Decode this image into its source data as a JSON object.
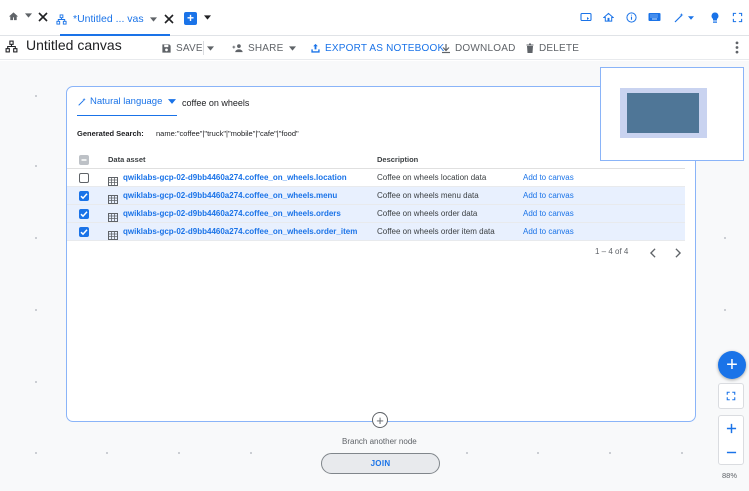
{
  "tabs": {
    "active_title": "*Untitled ... vas"
  },
  "toolbar": {
    "title": "Untitled canvas",
    "save": "SAVE",
    "share": "SHARE",
    "export": "EXPORT AS NOTEBOOK",
    "download": "DOWNLOAD",
    "delete": "DELETE"
  },
  "search": {
    "mode": "Natural language",
    "query": "coffee on wheels",
    "generated_label": "Generated Search:",
    "generated_value": "name:\"coffee\"|\"truck\"|\"mobile\"|\"cafe\"|\"food\""
  },
  "table": {
    "headers": {
      "asset": "Data asset",
      "description": "Description"
    },
    "rows": [
      {
        "asset": "qwiklabs-gcp-02-d9bb4460a274.coffee_on_wheels.location",
        "description": "Coffee on wheels location data",
        "action": "Add to canvas",
        "checked": false
      },
      {
        "asset": "qwiklabs-gcp-02-d9bb4460a274.coffee_on_wheels.menu",
        "description": "Coffee on wheels menu data",
        "action": "Add to canvas",
        "checked": true
      },
      {
        "asset": "qwiklabs-gcp-02-d9bb4460a274.coffee_on_wheels.orders",
        "description": "Coffee on wheels order data",
        "action": "Add to canvas",
        "checked": true
      },
      {
        "asset": "qwiklabs-gcp-02-d9bb4460a274.coffee_on_wheels.order_item",
        "description": "Coffee on wheels order item data",
        "action": "Add to canvas",
        "checked": true
      }
    ],
    "pagination": "1 – 4 of 4"
  },
  "node": {
    "branch_label": "Branch another node",
    "join_label": "JOIN"
  },
  "zoom": {
    "level": "88%"
  },
  "colors": {
    "accent": "#1a73e8",
    "selected_row": "#e8f0fe",
    "canvas_bg": "#f8f9fa"
  }
}
